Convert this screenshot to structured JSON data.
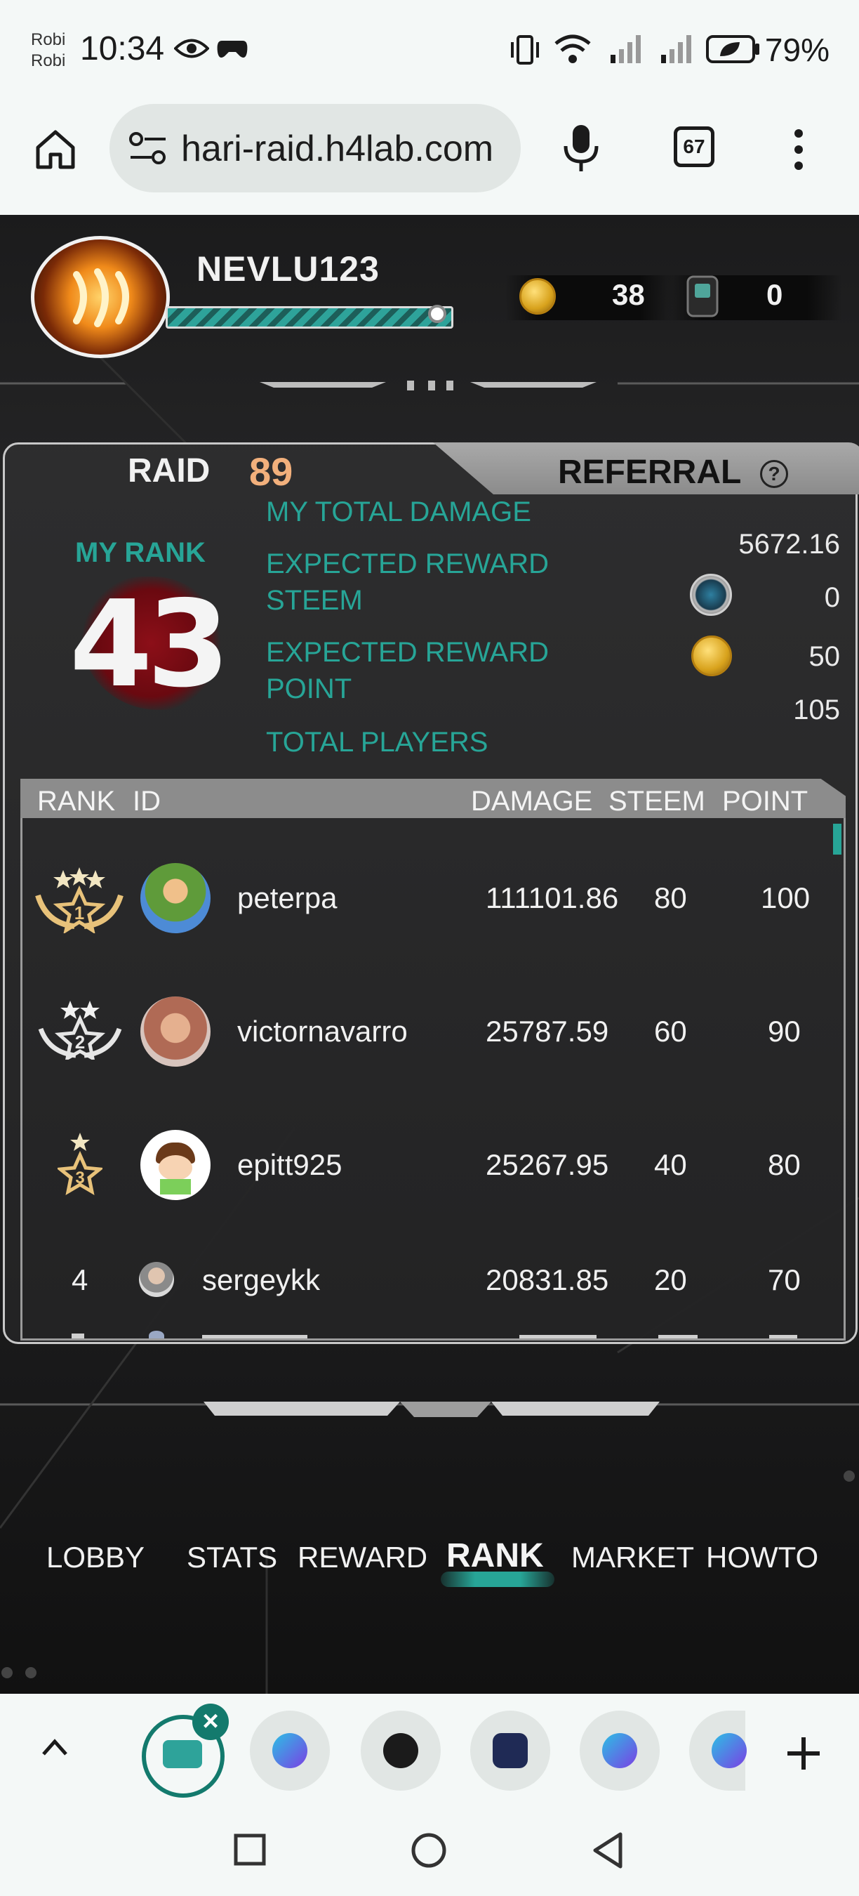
{
  "status_bar": {
    "carrier_line1": "Robi",
    "carrier_line2": "Robi",
    "time": "10:34",
    "battery_percent": "79%"
  },
  "browser": {
    "url": "hari-raid.h4lab.com",
    "tab_count": "67"
  },
  "player": {
    "name": "NEVLU123",
    "xp_fraction": 0.9,
    "coins": "38",
    "tokens": "0"
  },
  "panel": {
    "tab_raid": "RAID",
    "raid_number": "89",
    "tab_referral": "REFERRAL",
    "help": "?",
    "my_rank_label": "MY RANK",
    "my_rank": "43",
    "stats": {
      "total_damage_label": "MY TOTAL DAMAGE",
      "total_damage": "5672.16",
      "reward_steem_label": "EXPECTED REWARD STEEM",
      "reward_steem": "0",
      "reward_point_label": "EXPECTED REWARD POINT",
      "reward_point": "50",
      "total_players_label": "TOTAL PLAYERS",
      "total_players": "105"
    }
  },
  "table": {
    "headers": {
      "rank": "RANK",
      "id": "ID",
      "damage": "DAMAGE",
      "steem": "STEEM",
      "point": "POINT"
    },
    "rows": [
      {
        "rank": "1",
        "id": "peterpa",
        "damage": "111101.86",
        "steem": "80",
        "point": "100"
      },
      {
        "rank": "2",
        "id": "victornavarro",
        "damage": "25787.59",
        "steem": "60",
        "point": "90"
      },
      {
        "rank": "3",
        "id": "epitt925",
        "damage": "25267.95",
        "steem": "40",
        "point": "80"
      },
      {
        "rank": "4",
        "id": "sergeykk",
        "damage": "20831.85",
        "steem": "20",
        "point": "70"
      }
    ]
  },
  "game_nav": {
    "items": [
      "LOBBY",
      "STATS",
      "REWARD",
      "RANK",
      "MARKET",
      "HOWTO"
    ],
    "active": "RANK"
  },
  "colors": {
    "accent_teal": "#27a597",
    "raid_number": "#f2b07c",
    "blood_red": "#8c0f18"
  }
}
